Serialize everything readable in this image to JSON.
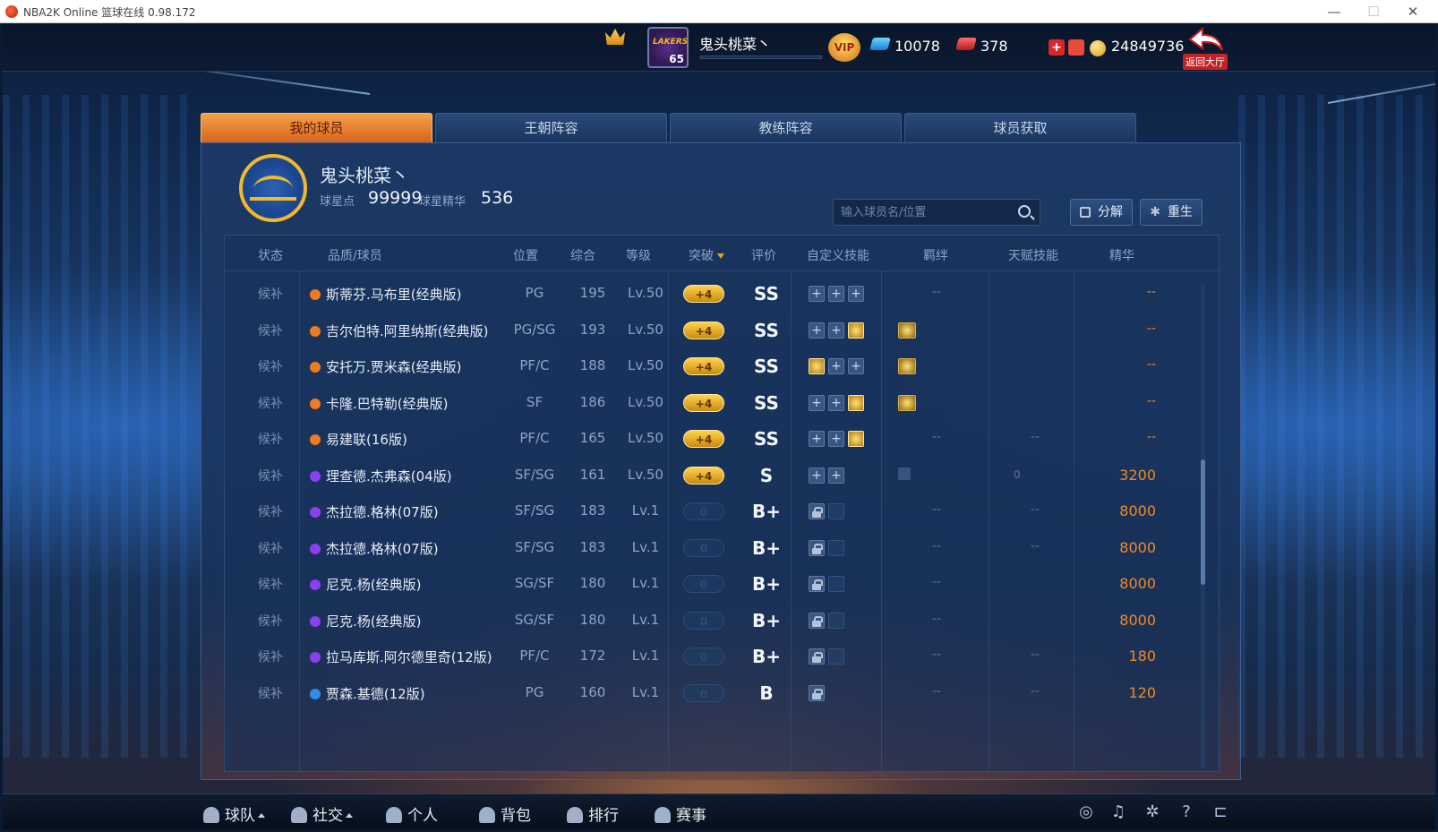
{
  "window": {
    "title": "NBA2K Online 篮球在线 0.98.172",
    "min_glyph": "—",
    "max_glyph": "☐",
    "close_glyph": "✕"
  },
  "topbar": {
    "team_abbr": "LAKERS",
    "level": "65",
    "username": "鬼头桃菜丶",
    "vip_label": "VIP",
    "tickets": "10078",
    "points": "378",
    "plus_glyph": "+",
    "coins": "24849736",
    "back_label": "返回大厅"
  },
  "tabs": [
    {
      "label": "我的球员",
      "active": true
    },
    {
      "label": "王朝阵容",
      "active": false
    },
    {
      "label": "教练阵容",
      "active": false
    },
    {
      "label": "球员获取",
      "active": false
    }
  ],
  "profile": {
    "name": "鬼头桃菜丶",
    "star_points_label": "球星点",
    "star_points": "99999",
    "essence_label": "球星精华",
    "essence": "536"
  },
  "search": {
    "placeholder": "输入球员名/位置"
  },
  "buttons": {
    "decompose": "分解",
    "rebirth": "重生"
  },
  "table": {
    "headers": {
      "status": "状态",
      "player": "品质/球员",
      "position": "位置",
      "overall": "综合",
      "level": "等级",
      "breakthrough": "突破",
      "rating": "评价",
      "custom_skills": "自定义技能",
      "bond": "羁绊",
      "talent": "天赋技能",
      "essence": "精华"
    },
    "rows": [
      {
        "status": "候补",
        "quality": "orange",
        "name": "斯蒂芬.马布里(经典版)",
        "pos": "PG",
        "ovr": "195",
        "lvl": "Lv.50",
        "bt": "+4",
        "grade": "SS",
        "skills": [
          "plus",
          "plus",
          "plus"
        ],
        "bond": "--",
        "talent": "",
        "essence": "--"
      },
      {
        "status": "候补",
        "quality": "orange",
        "name": "吉尔伯特.阿里纳斯(经典版)",
        "pos": "PG/SG",
        "ovr": "193",
        "lvl": "Lv.50",
        "bt": "+4",
        "grade": "SS",
        "skills": [
          "plus",
          "plus",
          "gold"
        ],
        "bond": "icon",
        "talent": "",
        "essence": "--"
      },
      {
        "status": "候补",
        "quality": "orange",
        "name": "安托万.贾米森(经典版)",
        "pos": "PF/C",
        "ovr": "188",
        "lvl": "Lv.50",
        "bt": "+4",
        "grade": "SS",
        "skills": [
          "gold",
          "plus",
          "plus"
        ],
        "bond": "icon",
        "talent": "",
        "essence": "--"
      },
      {
        "status": "候补",
        "quality": "orange",
        "name": "卡隆.巴特勒(经典版)",
        "pos": "SF",
        "ovr": "186",
        "lvl": "Lv.50",
        "bt": "+4",
        "grade": "SS",
        "skills": [
          "plus",
          "plus",
          "gold"
        ],
        "bond": "icon",
        "talent": "",
        "essence": "--"
      },
      {
        "status": "候补",
        "quality": "orange",
        "name": "易建联(16版)",
        "pos": "PF/C",
        "ovr": "165",
        "lvl": "Lv.50",
        "bt": "+4",
        "grade": "SS",
        "skills": [
          "plus",
          "plus",
          "gold"
        ],
        "bond": "--",
        "talent": "--",
        "essence": "--"
      },
      {
        "status": "候补",
        "quality": "purple",
        "name": "理查德.杰弗森(04版)",
        "pos": "SF/SG",
        "ovr": "161",
        "lvl": "Lv.50",
        "bt": "+4",
        "grade": "S",
        "skills": [
          "plus",
          "plus"
        ],
        "bond": "faded",
        "talent": "0",
        "essence": "3200"
      },
      {
        "status": "候补",
        "quality": "purple",
        "name": "杰拉德.格林(07版)",
        "pos": "SF/SG",
        "ovr": "183",
        "lvl": "Lv.1",
        "bt": "0",
        "grade": "B+",
        "skills": [
          "lock",
          "empty"
        ],
        "bond": "--",
        "talent": "--",
        "essence": "8000"
      },
      {
        "status": "候补",
        "quality": "purple",
        "name": "杰拉德.格林(07版)",
        "pos": "SF/SG",
        "ovr": "183",
        "lvl": "Lv.1",
        "bt": "0",
        "grade": "B+",
        "skills": [
          "lock",
          "empty"
        ],
        "bond": "--",
        "talent": "--",
        "essence": "8000"
      },
      {
        "status": "候补",
        "quality": "purple",
        "name": "尼克.杨(经典版)",
        "pos": "SG/SF",
        "ovr": "180",
        "lvl": "Lv.1",
        "bt": "0",
        "grade": "B+",
        "skills": [
          "lock",
          "empty"
        ],
        "bond": "--",
        "talent": "",
        "essence": "8000"
      },
      {
        "status": "候补",
        "quality": "purple",
        "name": "尼克.杨(经典版)",
        "pos": "SG/SF",
        "ovr": "180",
        "lvl": "Lv.1",
        "bt": "0",
        "grade": "B+",
        "skills": [
          "lock",
          "empty"
        ],
        "bond": "--",
        "talent": "",
        "essence": "8000"
      },
      {
        "status": "候补",
        "quality": "purple",
        "name": "拉马库斯.阿尔德里奇(12版)",
        "pos": "PF/C",
        "ovr": "172",
        "lvl": "Lv.1",
        "bt": "0",
        "grade": "B+",
        "skills": [
          "lock",
          "empty"
        ],
        "bond": "--",
        "talent": "--",
        "essence": "180"
      },
      {
        "status": "候补",
        "quality": "blue",
        "name": "贾森.基德(12版)",
        "pos": "PG",
        "ovr": "160",
        "lvl": "Lv.1",
        "bt": "0",
        "grade": "B",
        "skills": [
          "lock"
        ],
        "bond": "--",
        "talent": "--",
        "essence": "120"
      }
    ]
  },
  "quality_colors": {
    "orange": "#f07a22",
    "purple": "#8a3ff0",
    "blue": "#2f8fe6"
  },
  "bottom_nav": [
    {
      "label": "球队",
      "caret": true
    },
    {
      "label": "社交",
      "caret": true
    },
    {
      "label": "个人",
      "caret": false
    },
    {
      "label": "背包",
      "caret": false
    },
    {
      "label": "排行",
      "caret": false
    },
    {
      "label": "赛事",
      "caret": false
    }
  ],
  "system_icons": [
    {
      "name": "headset-icon",
      "glyph": "◎"
    },
    {
      "name": "music-icon",
      "glyph": "♫"
    },
    {
      "name": "settings-icon",
      "glyph": "✲"
    },
    {
      "name": "help-icon",
      "glyph": "?"
    },
    {
      "name": "exit-icon",
      "glyph": "⊏"
    }
  ]
}
